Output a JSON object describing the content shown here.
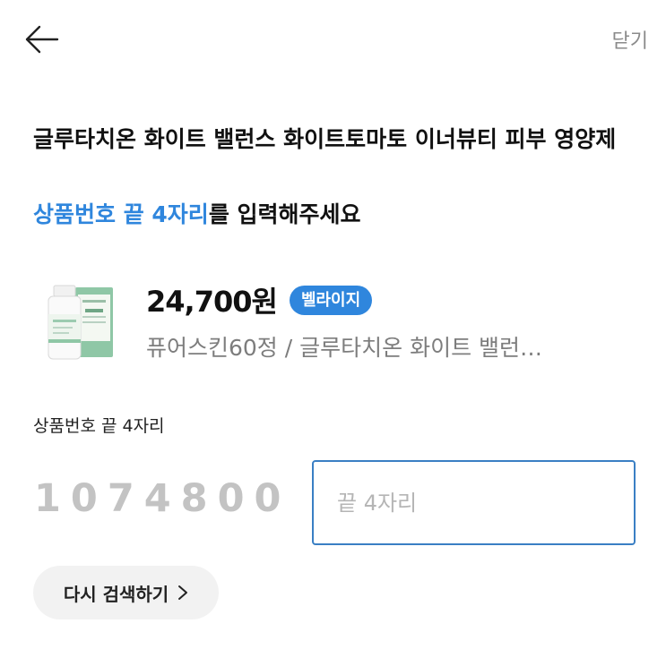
{
  "header": {
    "back_icon": "arrow-left-icon",
    "close_label": "닫기"
  },
  "product": {
    "title": "글루타치온 화이트 밸런스 화이트토마토 이너뷰티 피부 영양제",
    "price": "24,700원",
    "badge": "벨라이지",
    "name": "퓨어스킨60정 / 글루타치온 화이트 밸런…",
    "thumbnail_icon": "product-bottle-image"
  },
  "instruction": {
    "highlight": "상품번호 끝 4자리",
    "rest": "를 입력해주세요"
  },
  "verify": {
    "label": "상품번호 끝 4자리",
    "prefix": "1074800",
    "input_value": "",
    "input_placeholder": "끝 4자리"
  },
  "retry": {
    "label": "다시 검색하기",
    "icon": "chevron-right-icon"
  },
  "colors": {
    "accent": "#2f86dd",
    "input_border": "#3a7fc4",
    "muted_text": "#7d7d7d",
    "prefix_digits": "#c3c3c3",
    "button_bg": "#f2f2f2"
  }
}
